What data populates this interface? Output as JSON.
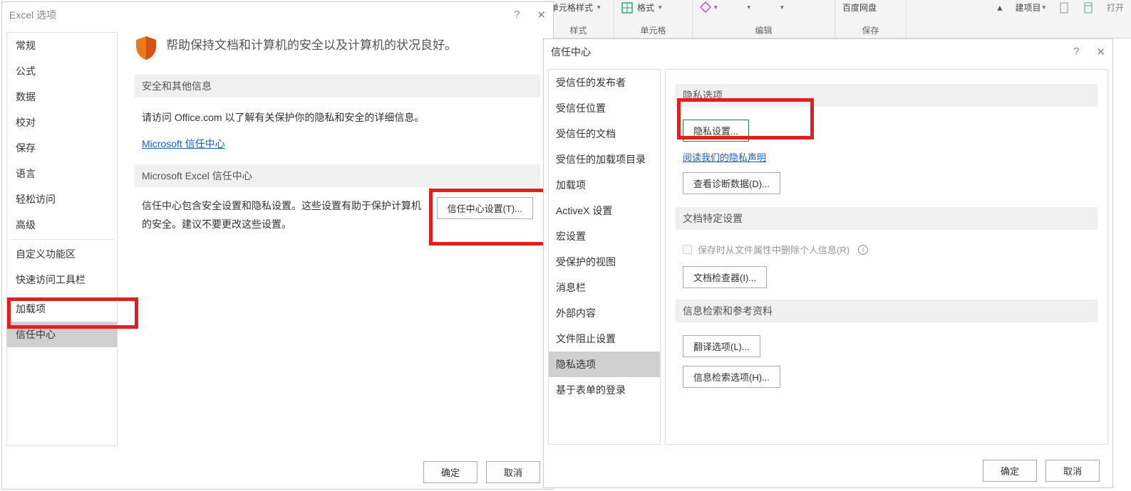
{
  "ribbon": {
    "groups": [
      {
        "top": "单元格样式",
        "label": "样式"
      },
      {
        "top": "格式",
        "label": "单元格"
      },
      {
        "top": "",
        "label": "编辑"
      },
      {
        "top": "百度网盘",
        "label": "保存"
      },
      {
        "top": "建项目",
        "label": ""
      }
    ],
    "open_label": "打开"
  },
  "win1": {
    "title": "Excel 选项",
    "sidebar": [
      "常规",
      "公式",
      "数据",
      "校对",
      "保存",
      "语言",
      "轻松访问",
      "高级",
      "自定义功能区",
      "快速访问工具栏",
      "加载项",
      "信任中心"
    ],
    "sidebar_selected": 11,
    "heading": "帮助保持文档和计算机的安全以及计算机的状况良好。",
    "sec1": "安全和其他信息",
    "sec1_text": "请访问 Office.com 以了解有关保护你的隐私和安全的详细信息。",
    "sec1_link": "Microsoft 信任中心",
    "sec2": "Microsoft Excel 信任中心",
    "sec2_text": "信任中心包含安全设置和隐私设置。这些设置有助于保护计算机的安全。建议不要更改这些设置。",
    "sec2_btn": "信任中心设置(T)...",
    "ok": "确定",
    "cancel": "取消"
  },
  "win2": {
    "title": "信任中心",
    "sidebar": [
      "受信任的发布者",
      "受信任位置",
      "受信任的文档",
      "受信任的加载项目录",
      "加载项",
      "ActiveX 设置",
      "宏设置",
      "受保护的视图",
      "消息栏",
      "外部内容",
      "文件阻止设置",
      "隐私选项",
      "基于表单的登录"
    ],
    "sidebar_selected": 11,
    "sec_privacy": "隐私选项",
    "btn_privacy": "隐私设置...",
    "link_privacy": "阅读我们的隐私声明",
    "btn_diag": "查看诊断数据(D)...",
    "sec_doc": "文档特定设置",
    "chk_remove": "保存时从文件属性中删除个人信息(R)",
    "btn_inspect": "文档检查器(I)...",
    "sec_research": "信息检索和参考资料",
    "btn_translate": "翻译选项(L)...",
    "btn_research": "信息检索选项(H)...",
    "ok": "确定",
    "cancel": "取消"
  }
}
